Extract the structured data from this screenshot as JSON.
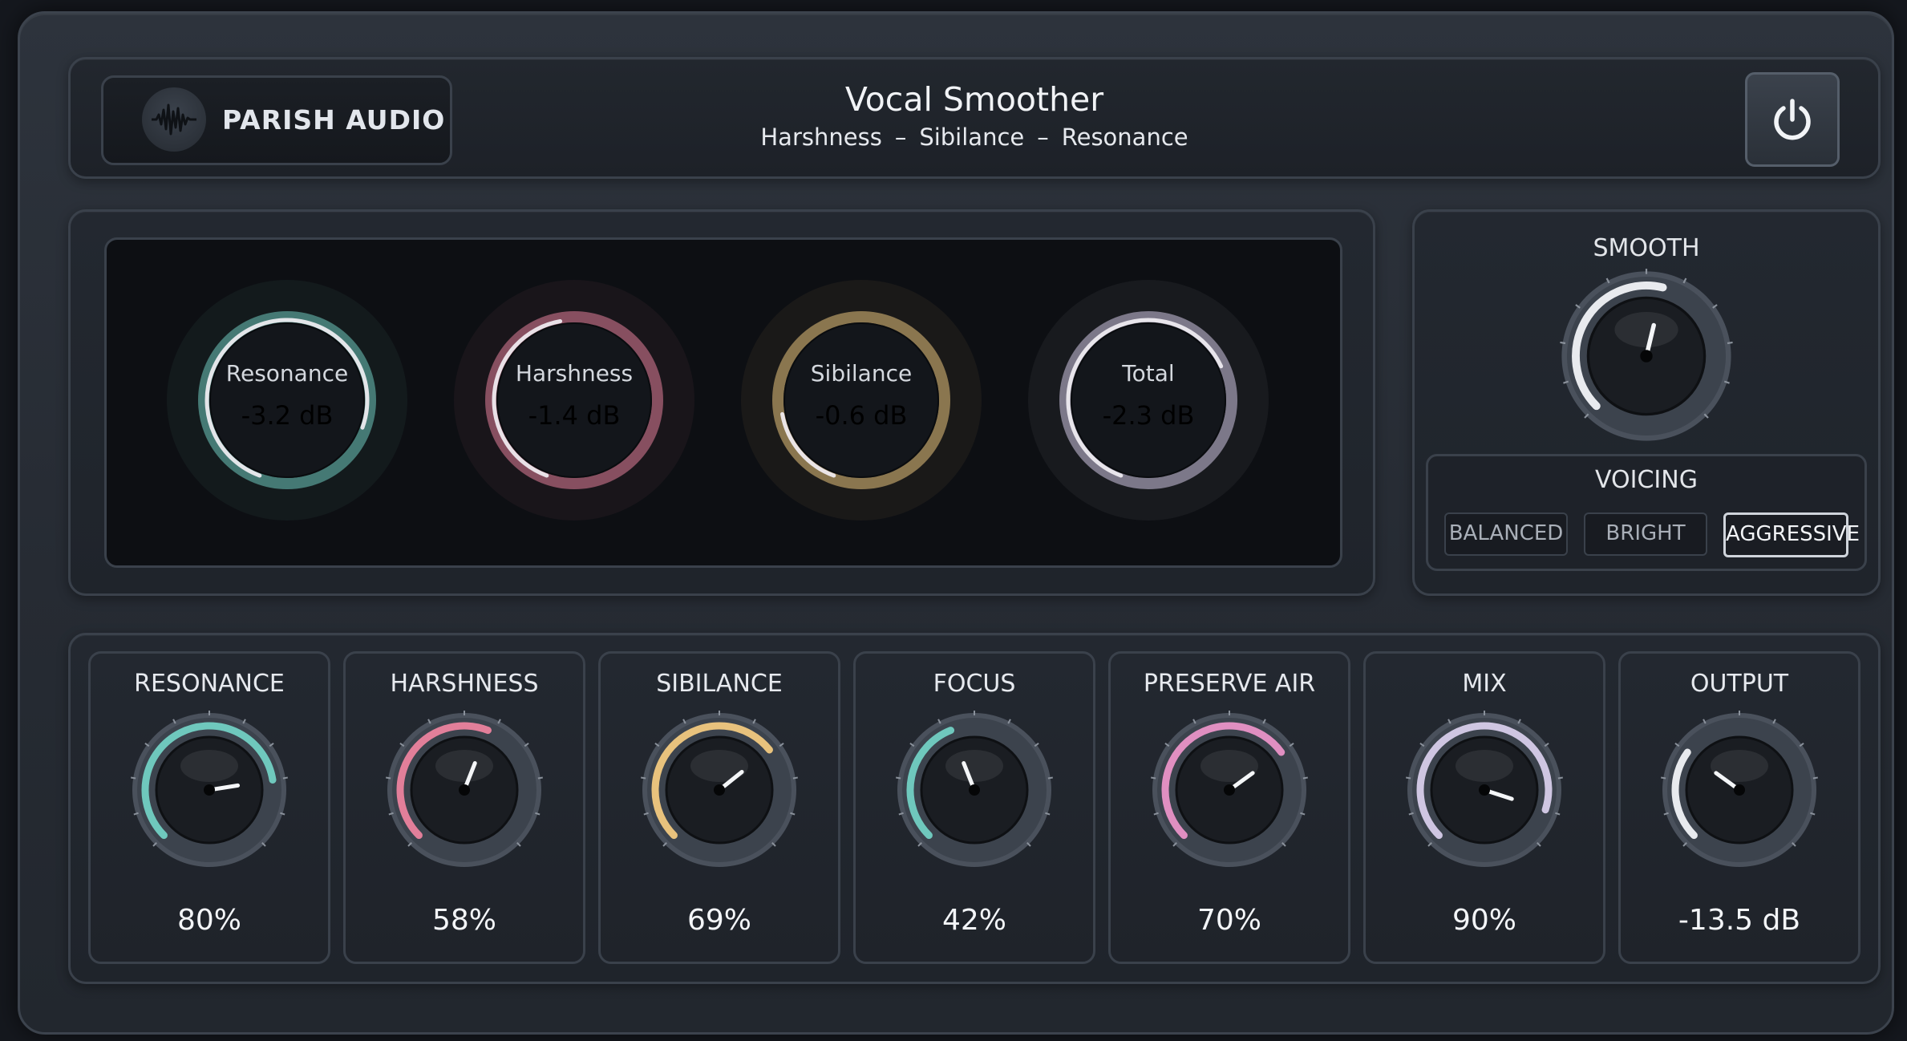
{
  "header": {
    "brand": "PARISH AUDIO",
    "title": "Vocal Smoother",
    "subtitle": [
      "Harshness",
      "Sibilance",
      "Resonance"
    ],
    "subtitle_separator": "–",
    "power_icon": "power-icon"
  },
  "meters": [
    {
      "label": "Resonance",
      "value": "-3.2 dB",
      "color": "#6fc8bd",
      "level": 0.9
    },
    {
      "label": "Harshness",
      "value": "-1.4 dB",
      "color": "#e27f9a",
      "level": 0.5
    },
    {
      "label": "Sibilance",
      "value": "-0.6 dB",
      "color": "#e8c27d",
      "level": 0.2
    },
    {
      "label": "Total",
      "value": "-2.3 dB",
      "color": "#cfc6e2",
      "level": 0.75
    }
  ],
  "smooth": {
    "label": "SMOOTH",
    "level": 0.55,
    "color": "#e8eaee"
  },
  "voicing": {
    "label": "VOICING",
    "options": [
      "BALANCED",
      "BRIGHT",
      "AGGRESSIVE"
    ],
    "selected": "AGGRESSIVE"
  },
  "knobs": [
    {
      "label": "RESONANCE",
      "value": "80%",
      "level": 0.8,
      "color": "#6fc8bd"
    },
    {
      "label": "HARSHNESS",
      "value": "58%",
      "level": 0.58,
      "color": "#e27f9a"
    },
    {
      "label": "SIBILANCE",
      "value": "69%",
      "level": 0.69,
      "color": "#e8c27d"
    },
    {
      "label": "FOCUS",
      "value": "42%",
      "level": 0.42,
      "color": "#6fc8bd"
    },
    {
      "label": "PRESERVE AIR",
      "value": "70%",
      "level": 0.7,
      "color": "#e08fc1"
    },
    {
      "label": "MIX",
      "value": "90%",
      "level": 0.9,
      "color": "#cfc6e2"
    },
    {
      "label": "OUTPUT",
      "value": "-13.5 dB",
      "level": 0.3,
      "color": "#e8eaee"
    }
  ]
}
